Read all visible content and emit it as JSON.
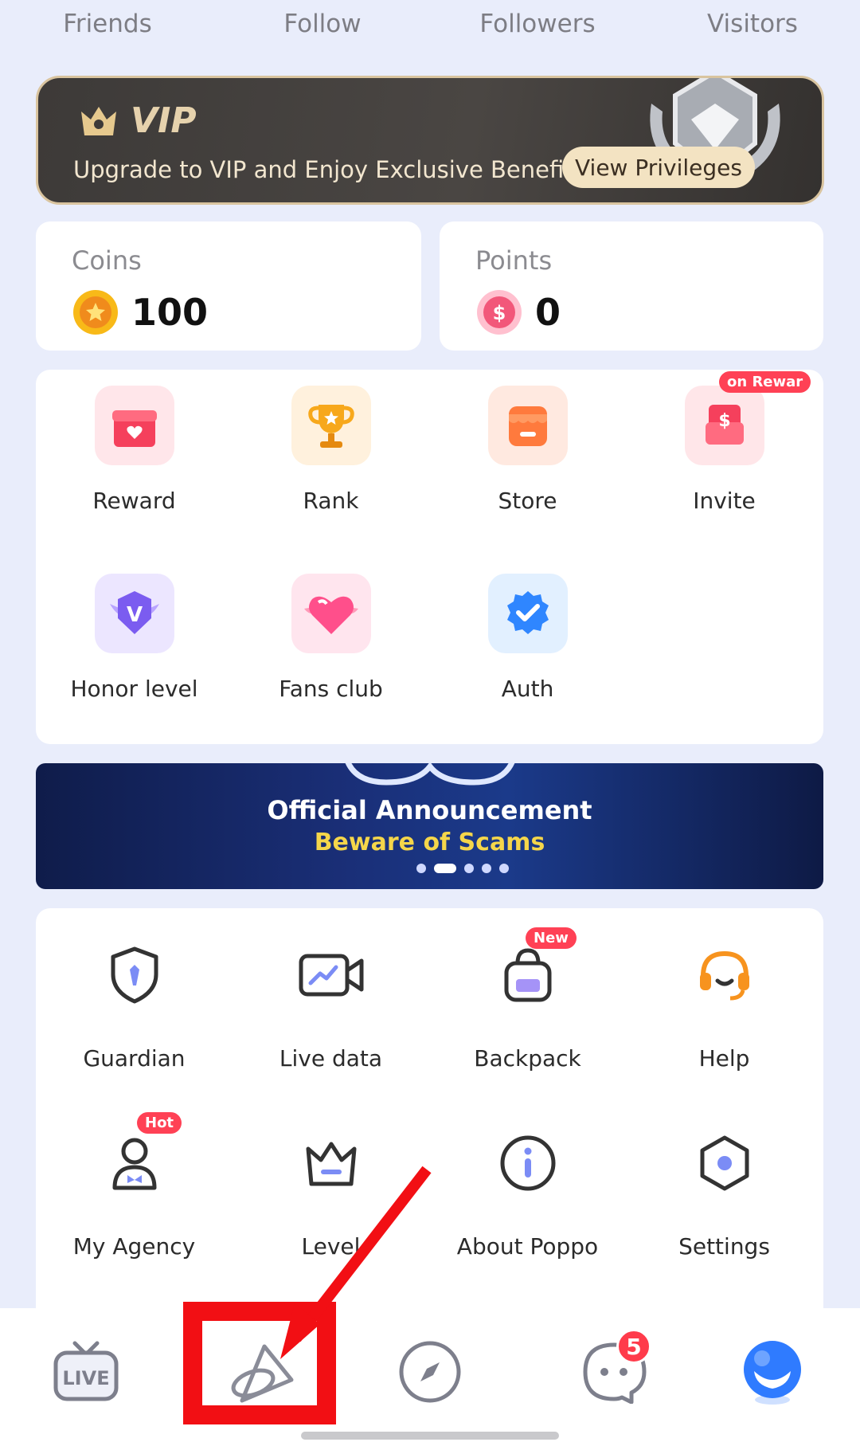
{
  "top_stats": [
    "Friends",
    "Follow",
    "Followers",
    "Visitors"
  ],
  "vip": {
    "title": "VIP",
    "subtitle": "Upgrade to VIP and Enjoy Exclusive Benefits",
    "button": "View Privileges"
  },
  "wallet": {
    "coins_label": "Coins",
    "coins_value": "100",
    "points_label": "Points",
    "points_value": "0"
  },
  "features": [
    {
      "label": "Reward",
      "icon": "gift-icon"
    },
    {
      "label": "Rank",
      "icon": "trophy-icon"
    },
    {
      "label": "Store",
      "icon": "store-icon"
    },
    {
      "label": "Invite",
      "icon": "red-envelope-icon",
      "badge": "on Rewar"
    },
    {
      "label": "Honor level",
      "icon": "honor-badge-icon"
    },
    {
      "label": "Fans club",
      "icon": "heart-icon"
    },
    {
      "label": "Auth",
      "icon": "verified-icon"
    }
  ],
  "banner": {
    "title": "Official Announcement",
    "subtitle": "Beware of Scams",
    "dots": 5,
    "active_dot": 1
  },
  "tools": [
    {
      "label": "Guardian",
      "icon": "shield-icon"
    },
    {
      "label": "Live data",
      "icon": "video-chart-icon"
    },
    {
      "label": "Backpack",
      "icon": "backpack-icon",
      "badge": "New"
    },
    {
      "label": "Help",
      "icon": "headset-icon"
    },
    {
      "label": "My Agency",
      "icon": "agency-icon",
      "badge": "Hot"
    },
    {
      "label": "Level",
      "icon": "crown-icon"
    },
    {
      "label": "About Poppo",
      "icon": "info-icon"
    },
    {
      "label": "Settings",
      "icon": "settings-icon"
    }
  ],
  "tabbar": {
    "live_label": "LIVE",
    "messages_badge": "5"
  },
  "colors": {
    "accent_red": "#ff4155",
    "highlight_red": "#f20f14",
    "vip_gold": "#e6d2ad",
    "banner_yellow": "#f5d64a"
  }
}
